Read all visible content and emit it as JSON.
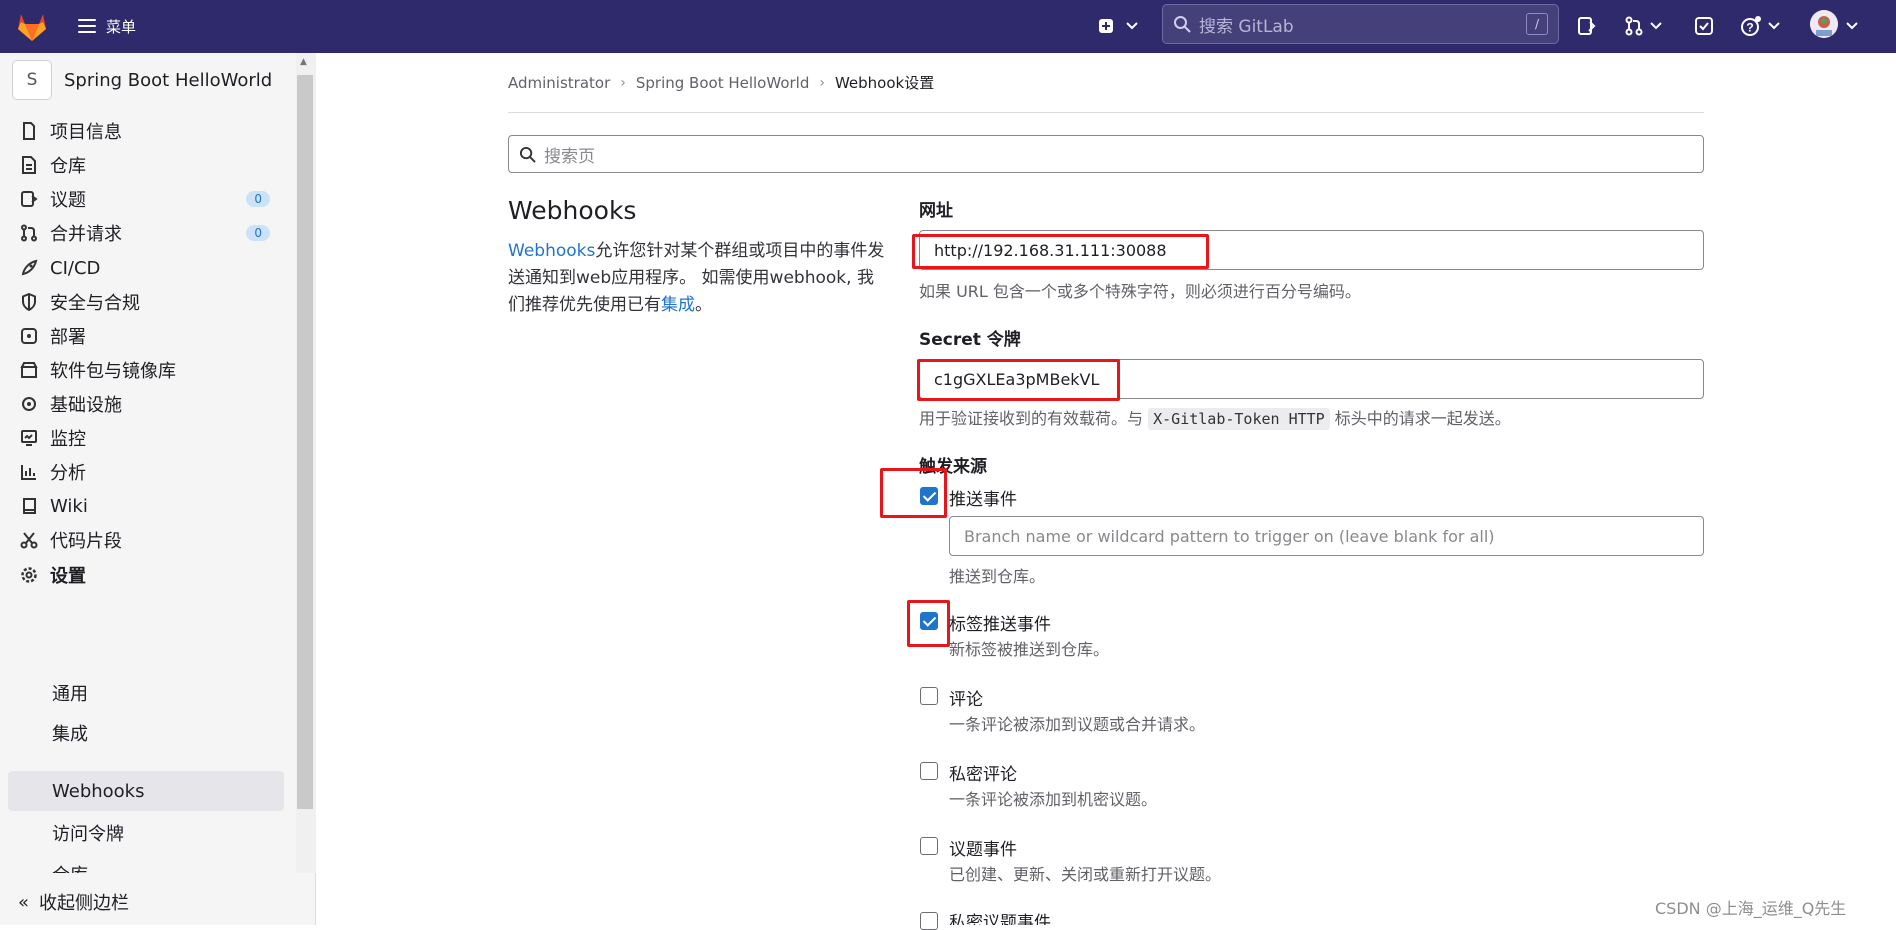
{
  "topbar": {
    "menu_label": "菜单",
    "search_placeholder": "搜索 GitLab",
    "search_shortcut": "/",
    "bg_color": "#2f2a6b"
  },
  "sidebar": {
    "project_initial": "S",
    "project_name": "Spring Boot HelloWorld",
    "items": [
      {
        "label": "项目信息",
        "icon": "project-info-icon"
      },
      {
        "label": "仓库",
        "icon": "repository-icon"
      },
      {
        "label": "议题",
        "icon": "issues-icon",
        "badge": "0"
      },
      {
        "label": "合并请求",
        "icon": "merge-request-icon",
        "badge": "0"
      },
      {
        "label": "CI/CD",
        "icon": "rocket-icon"
      },
      {
        "label": "安全与合规",
        "icon": "shield-icon"
      },
      {
        "label": "部署",
        "icon": "deployments-icon"
      },
      {
        "label": "软件包与镜像库",
        "icon": "package-icon"
      },
      {
        "label": "基础设施",
        "icon": "cloud-gear-icon"
      },
      {
        "label": "监控",
        "icon": "monitor-icon"
      },
      {
        "label": "分析",
        "icon": "chart-icon"
      },
      {
        "label": "Wiki",
        "icon": "book-icon"
      },
      {
        "label": "代码片段",
        "icon": "scissors-icon"
      },
      {
        "label": "设置",
        "icon": "gear-icon"
      }
    ],
    "sub_items": [
      "通用",
      "集成",
      "Webhooks",
      "访问令牌",
      "仓库"
    ],
    "collapse_label": "收起侧边栏"
  },
  "breadcrumb": [
    "Administrator",
    "Spring Boot HelloWorld",
    "Webhook设置"
  ],
  "page_search_placeholder": "搜索页",
  "webhooks": {
    "title": "Webhooks",
    "desc_link": "Webhooks",
    "desc_text1": "允许您针对某个群组或项目中的事件发送通知到web应用程序。 如需使用webhook, 我们推荐优先使用已有",
    "desc_link2": "集成",
    "desc_text2": "。"
  },
  "form": {
    "url_label": "网址",
    "url_value": "http://192.168.31.111:30088",
    "url_help": "如果 URL 包含一个或多个特殊字符，则必须进行百分号编码。",
    "secret_label": "Secret 令牌",
    "secret_value": "c1gGXLEa3pMBekVL",
    "secret_help_pre": "用于验证接收到的有效载荷。与",
    "secret_help_code": "X-Gitlab-Token HTTP",
    "secret_help_post": "标头中的请求一起发送。",
    "trigger_label": "触发来源",
    "branch_placeholder": "Branch name or wildcard pattern to trigger on (leave blank for all)",
    "triggers": [
      {
        "label": "推送事件",
        "help": "推送到仓库。",
        "checked": true
      },
      {
        "label": "标签推送事件",
        "help": "新标签被推送到仓库。",
        "checked": true
      },
      {
        "label": "评论",
        "help": "一条评论被添加到议题或合并请求。",
        "checked": false
      },
      {
        "label": "私密评论",
        "help": "一条评论被添加到机密议题。",
        "checked": false
      },
      {
        "label": "议题事件",
        "help": "已创建、更新、关闭或重新打开议题。",
        "checked": false
      },
      {
        "label": "私密议题事件",
        "help": "",
        "checked": false
      }
    ]
  },
  "watermark": "CSDN @上海_运维_Q先生"
}
